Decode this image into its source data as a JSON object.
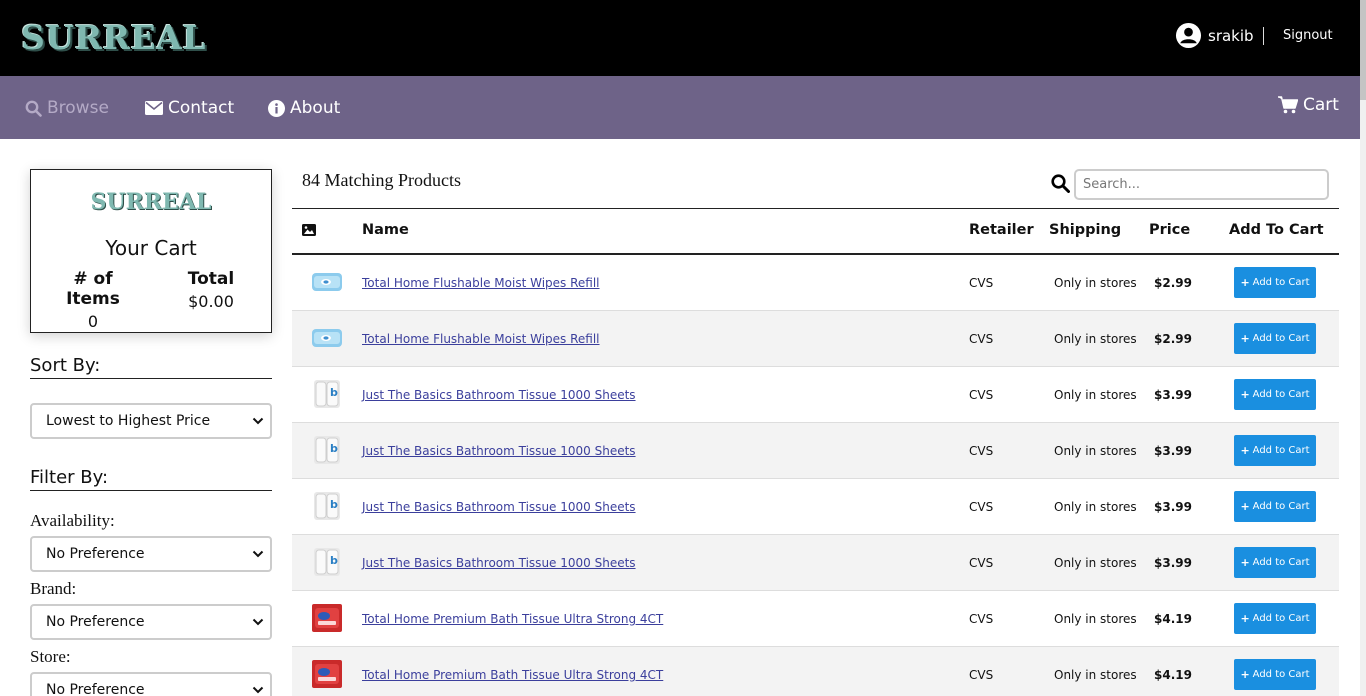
{
  "header": {
    "logo": "SURREAL",
    "username": "srakib",
    "signout": "Signout"
  },
  "nav": {
    "browse": "Browse",
    "contact": "Contact",
    "about": "About",
    "cart": "Cart"
  },
  "cart_box": {
    "logo": "SURREAL",
    "title": "Your Cart",
    "items_label": "# of Items",
    "items_value": "0",
    "total_label": "Total",
    "total_value": "$0.00"
  },
  "sidebar": {
    "sort_heading": "Sort By:",
    "sort_value": "Lowest to Highest Price",
    "filter_heading": "Filter By:",
    "availability_label": "Availability:",
    "availability_value": "No Preference",
    "brand_label": "Brand:",
    "brand_value": "No Preference",
    "store_label": "Store:",
    "store_value": "No Preference"
  },
  "main": {
    "match_count": "84 Matching Products",
    "search_placeholder": "Search..."
  },
  "table": {
    "headers": {
      "name": "Name",
      "retailer": "Retailer",
      "shipping": "Shipping",
      "price": "Price",
      "add": "Add To Cart"
    },
    "add_label": "Add to Cart",
    "rows": [
      {
        "thumb": "wipes",
        "name": "Total Home Flushable Moist Wipes Refill",
        "retailer": "CVS",
        "shipping": "Only in stores",
        "price": "$2.99"
      },
      {
        "thumb": "wipes",
        "name": "Total Home Flushable Moist Wipes Refill",
        "retailer": "CVS",
        "shipping": "Only in stores",
        "price": "$2.99"
      },
      {
        "thumb": "tissue",
        "name": "Just The Basics Bathroom Tissue 1000 Sheets",
        "retailer": "CVS",
        "shipping": "Only in stores",
        "price": "$3.99"
      },
      {
        "thumb": "tissue",
        "name": "Just The Basics Bathroom Tissue 1000 Sheets",
        "retailer": "CVS",
        "shipping": "Only in stores",
        "price": "$3.99"
      },
      {
        "thumb": "tissue",
        "name": "Just The Basics Bathroom Tissue 1000 Sheets",
        "retailer": "CVS",
        "shipping": "Only in stores",
        "price": "$3.99"
      },
      {
        "thumb": "tissue",
        "name": "Just The Basics Bathroom Tissue 1000 Sheets",
        "retailer": "CVS",
        "shipping": "Only in stores",
        "price": "$3.99"
      },
      {
        "thumb": "premium",
        "name": "Total Home Premium Bath Tissue Ultra Strong 4CT",
        "retailer": "CVS",
        "shipping": "Only in stores",
        "price": "$4.19"
      },
      {
        "thumb": "premium",
        "name": "Total Home Premium Bath Tissue Ultra Strong 4CT",
        "retailer": "CVS",
        "shipping": "Only in stores",
        "price": "$4.19"
      }
    ]
  },
  "colors": {
    "nav_bg": "#6e6388",
    "button_blue": "#1a8fe0",
    "logo_teal": "#7fb8b0"
  }
}
